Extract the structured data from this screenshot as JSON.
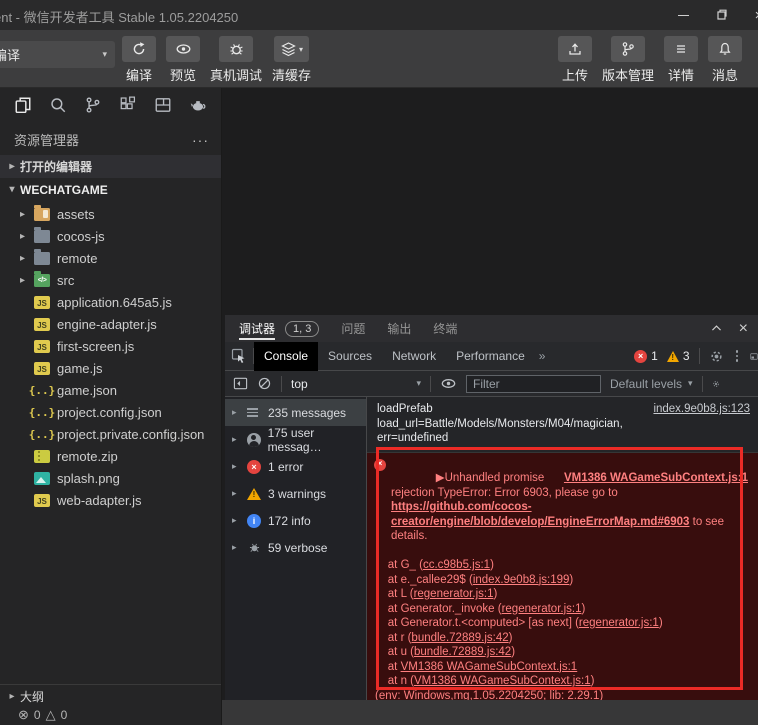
{
  "window": {
    "title": "ent - 微信开发者工具 Stable 1.05.2204250"
  },
  "icons": {
    "collapsed": "▸",
    "expanded": "▾",
    "caret_down": "▾",
    "more_h": "···",
    "more_tabs": "»",
    "x": "×",
    "excl": "!",
    "info_i": "i",
    "js_badge": "JS",
    "json_badge": "{..}",
    "code_glyph": "</>",
    "prompt": ">",
    "error_circle": "⊗",
    "warn_triangle": "△",
    "close": "×"
  },
  "colors": {
    "annotation_red": "#ec2b26",
    "error_text": "#ff8080",
    "error_bg": "#380d0d",
    "badge_red": "#e4443f",
    "badge_yellow": "#f2a600",
    "info_blue": "#4285f4",
    "prompt_blue": "#4e8bed",
    "js_yellow": "#e0ca4e",
    "assets_tan": "#d7a65f",
    "src_green": "#55a35f",
    "png_teal": "#2fb3a3"
  },
  "toolbar": {
    "compile_mode": "普通编译",
    "compile": "编译",
    "preview": "预览",
    "remote_debug": "真机调试",
    "clear_cache": "清缓存",
    "upload": "上传",
    "version": "版本管理",
    "details": "详情",
    "messages": "消息"
  },
  "sidebar": {
    "explorer_title": "资源管理器",
    "open_editors": "打开的编辑器",
    "project_name": "WECHATGAME",
    "outline": "大纲",
    "files": [
      {
        "label": "assets"
      },
      {
        "label": "cocos-js"
      },
      {
        "label": "remote"
      },
      {
        "label": "src"
      },
      {
        "label": "application.645a5.js"
      },
      {
        "label": "engine-adapter.js"
      },
      {
        "label": "first-screen.js"
      },
      {
        "label": "game.js"
      },
      {
        "label": "game.json"
      },
      {
        "label": "project.config.json"
      },
      {
        "label": "project.private.config.json"
      },
      {
        "label": "remote.zip"
      },
      {
        "label": "splash.png"
      },
      {
        "label": "web-adapter.js"
      }
    ],
    "status": {
      "errors": "0",
      "warnings": "0"
    }
  },
  "debug": {
    "tabs": {
      "debugger": "调试器",
      "badge": "1, 3",
      "problems": "问题",
      "output": "输出",
      "terminal": "终端"
    },
    "devtools": {
      "tab_console": "Console",
      "tab_sources": "Sources",
      "tab_network": "Network",
      "tab_performance": "Performance",
      "error_count": "1",
      "warning_count": "3",
      "frame": "top",
      "filter_placeholder": "Filter",
      "levels": "Default levels",
      "message_filters": [
        {
          "label": "235 messages"
        },
        {
          "label": "175 user messag…"
        },
        {
          "label": "1 error"
        },
        {
          "label": "3 warnings"
        },
        {
          "label": "172 info"
        },
        {
          "label": "59 verbose"
        }
      ],
      "console": {
        "log": {
          "line1": "loadPrefab",
          "source": "index.9e0b8.js:123",
          "line2": "load_url=Battle/Models/Monsters/M04/magician,",
          "line3": "err=undefined"
        },
        "error": {
          "source": "VM1386 WAGameSubContext.js:1",
          "text_before": "▶Unhandled promise rejection TypeError: Error 6903, please go to ",
          "link": "https://github.com/cocos-creator/engine/blob/develop/EngineErrorMap.md#6903",
          "text_after": " to see details.",
          "stack": [
            {
              "pre": "    at G_ (",
              "link": "cc.c98b5.js:1",
              "post": ")"
            },
            {
              "pre": "    at e._callee29$ (",
              "link": "index.9e0b8.js:199",
              "post": ")"
            },
            {
              "pre": "    at L (",
              "link": "regenerator.js:1",
              "post": ")"
            },
            {
              "pre": "    at Generator._invoke (",
              "link": "regenerator.js:1",
              "post": ")"
            },
            {
              "pre": "    at Generator.t.<computed> [as next] (",
              "link": "regenerator.js:1",
              "post": ")"
            },
            {
              "pre": "    at r (",
              "link": "bundle.72889.js:42",
              "post": ")"
            },
            {
              "pre": "    at u (",
              "link": "bundle.72889.js:42",
              "post": ")"
            },
            {
              "pre": "    at ",
              "link": "VM1386 WAGameSubContext.js:1",
              "post": ""
            },
            {
              "pre": "    at n (",
              "link": "VM1386 WAGameSubContext.js:1",
              "post": ")"
            }
          ],
          "env": "(env: Windows,mg,1.05.2204250; lib: 2.29.1)"
        }
      }
    }
  }
}
